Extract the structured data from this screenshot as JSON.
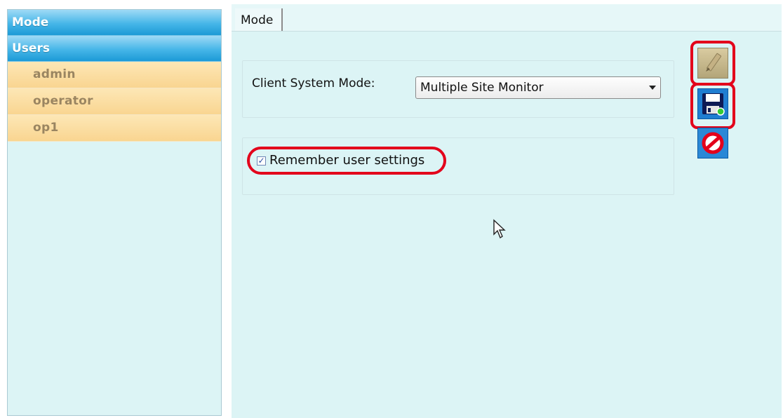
{
  "sidebar": {
    "sections": [
      {
        "label": "Mode"
      },
      {
        "label": "Users"
      }
    ],
    "users": [
      {
        "label": "admin"
      },
      {
        "label": "operator"
      },
      {
        "label": "op1"
      }
    ]
  },
  "main": {
    "tab_label": "Mode",
    "mode_label": "Client System Mode:",
    "mode_value": "Multiple Site Monitor",
    "remember_label": "Remember user settings",
    "remember_checked": true,
    "check_glyph": "✓"
  },
  "toolbar": {
    "edit_icon": "pencil-icon",
    "save_icon": "floppy-disk-icon",
    "cancel_icon": "no-entry-icon"
  },
  "colors": {
    "highlight": "#e3001b",
    "header_blue": "#46b6e8",
    "user_item": "#f9d591",
    "panel_bg": "#dcf4f5"
  }
}
